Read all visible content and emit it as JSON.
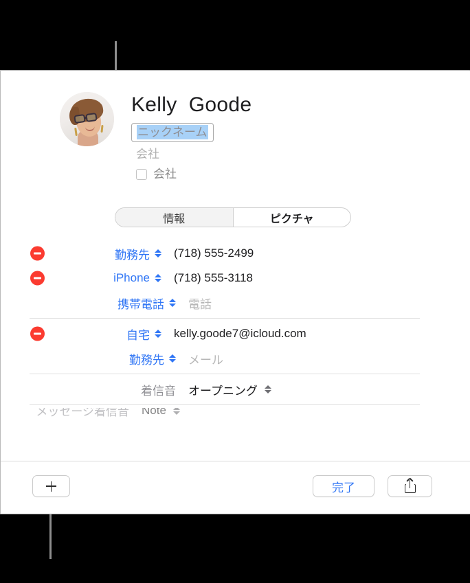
{
  "callouts": {
    "top_leader": "leader-line-to-nickname-field",
    "bottom_leader": "leader-line-to-add-button"
  },
  "contact": {
    "name": "Kelly  Goode",
    "avatar_alt": "contact-photo",
    "nickname_placeholder": "ニックネーム",
    "company_placeholder": "会社",
    "company_checkbox_label": "会社",
    "company_checkbox_checked": false
  },
  "tabs": [
    {
      "label": "情報",
      "selected": true
    },
    {
      "label": "ピクチャ",
      "selected": false
    }
  ],
  "fields": [
    {
      "removable": true,
      "label": "勤務先",
      "label_color": "#3076f5",
      "stepper": true,
      "value": "(718) 555-2499",
      "is_placeholder": false,
      "divider_after": false
    },
    {
      "removable": true,
      "label": "iPhone",
      "label_color": "#3076f5",
      "stepper": true,
      "value": "(718) 555-3118",
      "is_placeholder": false,
      "divider_after": false
    },
    {
      "removable": false,
      "label": "携帯電話",
      "label_color": "#3076f5",
      "stepper": true,
      "value": "電話",
      "is_placeholder": true,
      "divider_after": true
    },
    {
      "removable": true,
      "label": "自宅",
      "label_color": "#3076f5",
      "stepper": true,
      "value": "kelly.goode7@icloud.com",
      "is_placeholder": false,
      "divider_after": false
    },
    {
      "removable": false,
      "label": "勤務先",
      "label_color": "#3076f5",
      "stepper": true,
      "value": "メール",
      "is_placeholder": true,
      "divider_after": true
    },
    {
      "removable": false,
      "label": "着信音",
      "label_color": "#8e8e93",
      "stepper": false,
      "value": "オープニング",
      "value_stepper": true,
      "is_placeholder": false,
      "divider_after": true
    }
  ],
  "clipped_row": {
    "label": "メッセージ着信音",
    "value": "Note"
  },
  "toolbar": {
    "add_label": "plus-icon",
    "done_label": "完了",
    "share_label": "share-icon"
  },
  "colors": {
    "accent_blue": "#3076f5",
    "remove_red": "#fb3b30",
    "selection_blue": "#a8d1f7",
    "placeholder_gray": "#b6b6b6",
    "callout_gray": "#8e8e8e",
    "backdrop": "#000000"
  }
}
